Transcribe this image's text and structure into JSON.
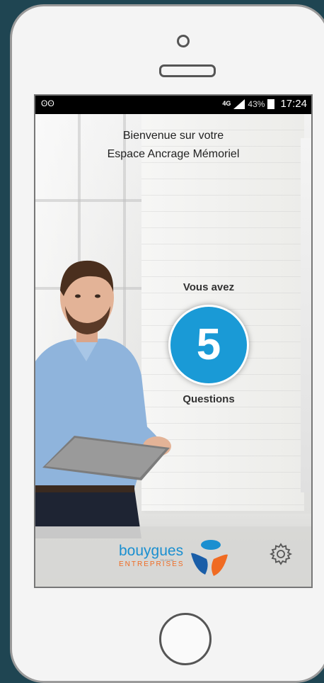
{
  "status_bar": {
    "network": "4G",
    "battery": "43%",
    "time": "17:24"
  },
  "welcome": {
    "line1": "Bienvenue sur votre",
    "line2": "Espace Ancrage Mémoriel"
  },
  "questions_panel": {
    "prefix": "Vous avez",
    "count": "5",
    "suffix": "Questions",
    "circle_color": "#1a9ad6"
  },
  "footer": {
    "logo_word": "bouygues",
    "logo_small": "TELECOM",
    "logo_sub": "ENTREPRISES",
    "logo_blue": "#1a8fd0",
    "logo_orange": "#f06b22",
    "settings_icon": "gear-icon"
  }
}
